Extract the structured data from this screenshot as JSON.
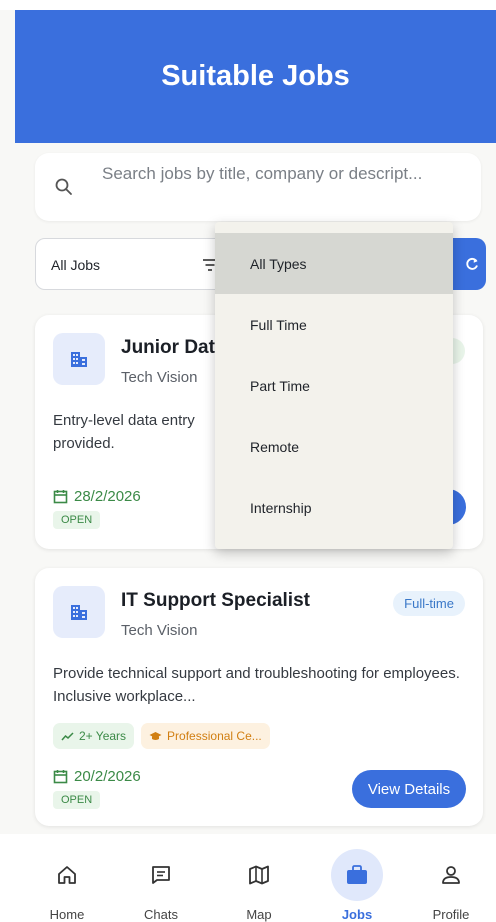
{
  "app_bar": {
    "title": "Suitable Jobs"
  },
  "search": {
    "placeholder": "Search jobs by title, company or descript..."
  },
  "filter": {
    "selected": "All Jobs"
  },
  "dropdown": {
    "options": [
      "All Types",
      "Full Time",
      "Part Time",
      "Remote",
      "Internship"
    ],
    "selected": "All Types"
  },
  "jobs": [
    {
      "title": "Junior Dat",
      "company": "Tech Vision",
      "description": "Entry-level data entry provided.",
      "date": "28/2/2026",
      "status": "OPEN"
    },
    {
      "title": "IT Support Specialist",
      "company": "Tech Vision",
      "type": "Full-time",
      "description": "Provide technical support and troubleshooting for employees. Inclusive workplace...",
      "tags": [
        "2+ Years",
        "Professional Ce..."
      ],
      "date": "20/2/2026",
      "status": "OPEN",
      "action": "View Details"
    }
  ],
  "nav": {
    "items": [
      {
        "label": "Home",
        "icon": "home-icon"
      },
      {
        "label": "Chats",
        "icon": "chat-icon"
      },
      {
        "label": "Map",
        "icon": "map-icon"
      },
      {
        "label": "Jobs",
        "icon": "briefcase-icon"
      },
      {
        "label": "Profile",
        "icon": "profile-icon"
      }
    ],
    "active": "Jobs"
  },
  "colors": {
    "primary": "#3a6fdd",
    "success": "#3b8a47",
    "warning": "#d17f12",
    "info": "#3a78c8",
    "menu_bg": "#f3f2ec",
    "menu_selected": "#d6d7d2"
  }
}
